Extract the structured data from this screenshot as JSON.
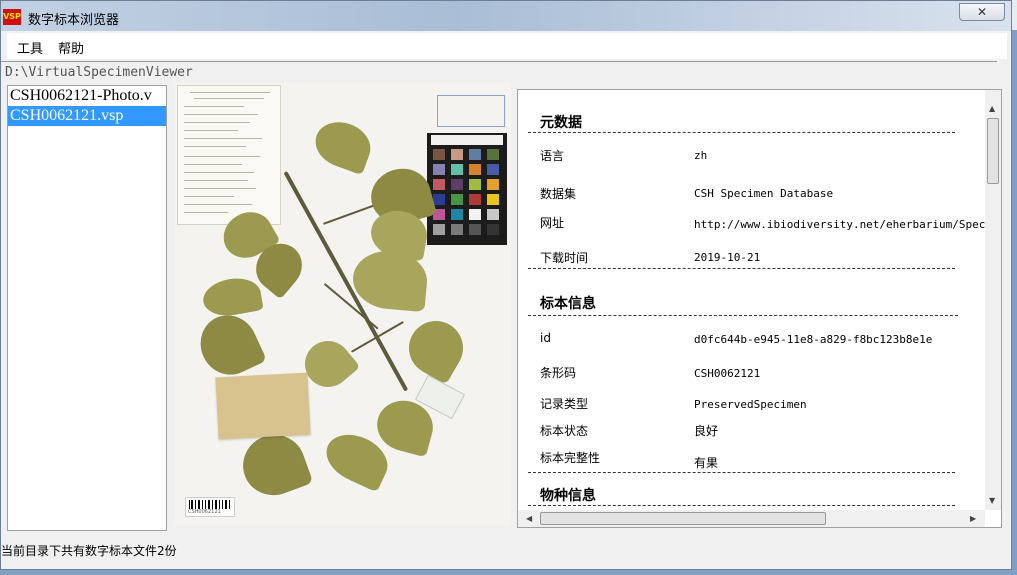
{
  "window": {
    "title": "数字标本浏览器",
    "icon_text": "VSP",
    "close_label": "✕"
  },
  "menu": {
    "items": [
      {
        "label": "工具"
      },
      {
        "label": "帮助"
      }
    ]
  },
  "path": "D:\\VirtualSpecimenViewer",
  "files": [
    {
      "name": "CSH0062121-Photo.v",
      "selected": false
    },
    {
      "name": "CSH0062121.vsp",
      "selected": true
    }
  ],
  "specimen": {
    "barcode_text": "CSH0062121",
    "checker_brand": "colorchecker"
  },
  "info": {
    "sections": [
      {
        "title": "元数据",
        "fields": [
          {
            "key": "语言",
            "value": "zh"
          },
          {
            "key": "数据集",
            "value": "CSH Specimen Database"
          },
          {
            "key": "网址",
            "value": "http://www.ibiodiversity.net/eherbarium/Specimen"
          },
          {
            "key": "下载时间",
            "value": "2019-10-21"
          }
        ]
      },
      {
        "title": "标本信息",
        "fields": [
          {
            "key": "id",
            "value": "d0fc644b-e945-11e8-a829-f8bc123b8e1e"
          },
          {
            "key": "条形码",
            "value": "CSH0062121"
          },
          {
            "key": "记录类型",
            "value": "PreservedSpecimen"
          },
          {
            "key": "标本状态",
            "value": "良好"
          },
          {
            "key": "标本完整性",
            "value": "有果"
          }
        ]
      },
      {
        "title": "物种信息",
        "fields": []
      }
    ]
  },
  "status": "当前目录下共有数字标本文件2份",
  "colors": {
    "selection": "#3399ff",
    "leaf": "#9b9a4f",
    "envelope": "#d8c38e"
  }
}
